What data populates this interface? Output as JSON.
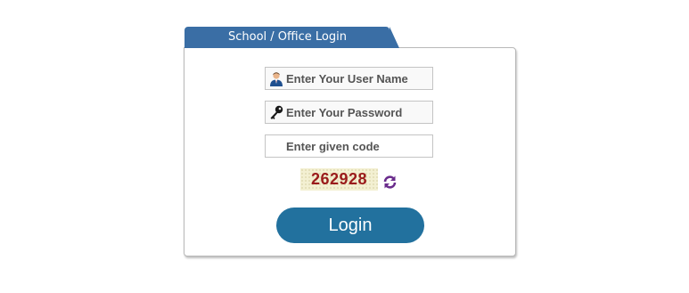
{
  "tab": {
    "title": "School / Office Login"
  },
  "form": {
    "username": {
      "placeholder": "Enter Your User Name",
      "icon": "user-icon"
    },
    "password": {
      "placeholder": "Enter Your Password",
      "icon": "key-icon"
    },
    "code": {
      "placeholder": "Enter given code"
    },
    "captcha": {
      "value": "262928",
      "refresh_icon": "refresh-icon"
    },
    "login_label": "Login"
  },
  "colors": {
    "tab_bg": "#3a6ea5",
    "button_bg": "#22719e",
    "captcha_text": "#9a1b1b",
    "refresh_icon": "#6a2c8c"
  }
}
